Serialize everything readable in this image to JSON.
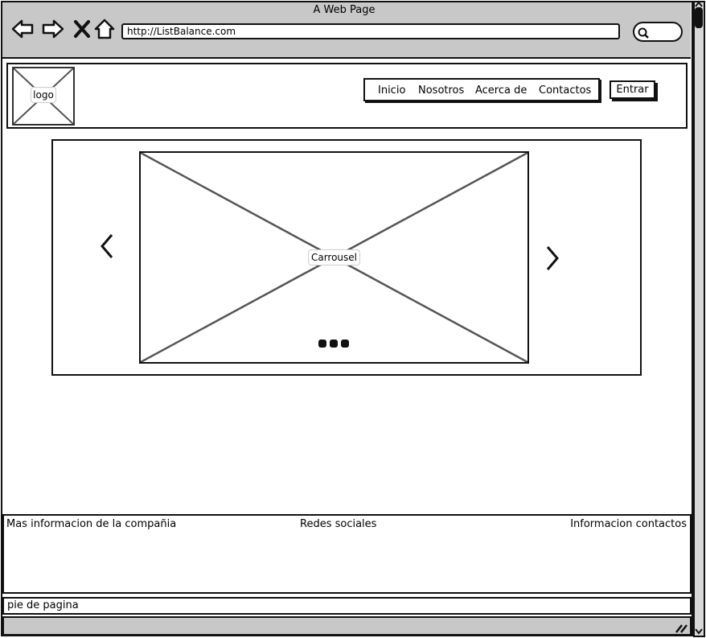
{
  "window": {
    "title": "A Web Page",
    "url": "http://ListBalance.com"
  },
  "toolbar_icons": [
    "back-arrow-icon",
    "forward-arrow-icon",
    "close-x-icon",
    "home-icon",
    "search-icon"
  ],
  "header": {
    "logo_label": "logo",
    "nav": [
      "Inicio",
      "Nosotros",
      "Acerca de",
      "Contactos"
    ],
    "login_label": "Entrar"
  },
  "carousel": {
    "label": "Carrousel",
    "prev_icon": "chevron-left-icon",
    "next_icon": "chevron-right-icon",
    "indicator_count": 3
  },
  "footer": {
    "left": "Mas informacion de la compañia",
    "center": "Redes sociales",
    "right": "Informacion contactos",
    "bottom": "pie de pagina"
  },
  "colors": {
    "chrome": "#c8c8c8",
    "stroke": "#111111",
    "placeholder_cross": "#555555"
  }
}
